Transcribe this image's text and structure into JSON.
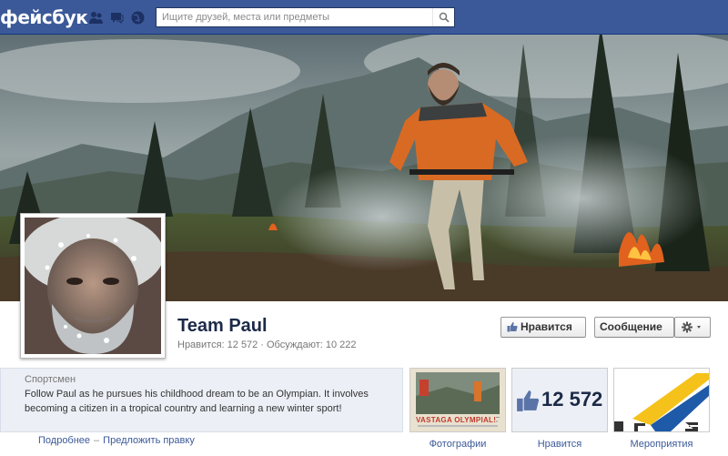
{
  "header": {
    "logo": "фейсбук",
    "search_placeholder": "Ищите друзей, места или предметы"
  },
  "page": {
    "name": "Team Paul",
    "likes_label": "Нравится: 12 572",
    "talking_label": "Обсуждают: 10 222",
    "separator": "·"
  },
  "actions": {
    "like_label": "Нравится",
    "message_label": "Сообщение"
  },
  "about": {
    "category": "Спортсмен",
    "description": "Follow Paul as he pursues his childhood dream to be an Olympian. It involves becoming a citizen in a tropical country and learning a new winter sport!",
    "more_link": "Подробнее",
    "link_separator": "–",
    "suggest_link": "Предложить правку"
  },
  "apps": [
    {
      "label": "Фотографии"
    },
    {
      "label": "Нравится",
      "count": "12 572"
    },
    {
      "label": "Мероприятия"
    }
  ],
  "photo_caption": "VASTAGA OLYMPIAL!",
  "colors": {
    "brand_blue": "#3b5998",
    "link_blue": "#3b5998",
    "about_bg": "#eceff5"
  }
}
